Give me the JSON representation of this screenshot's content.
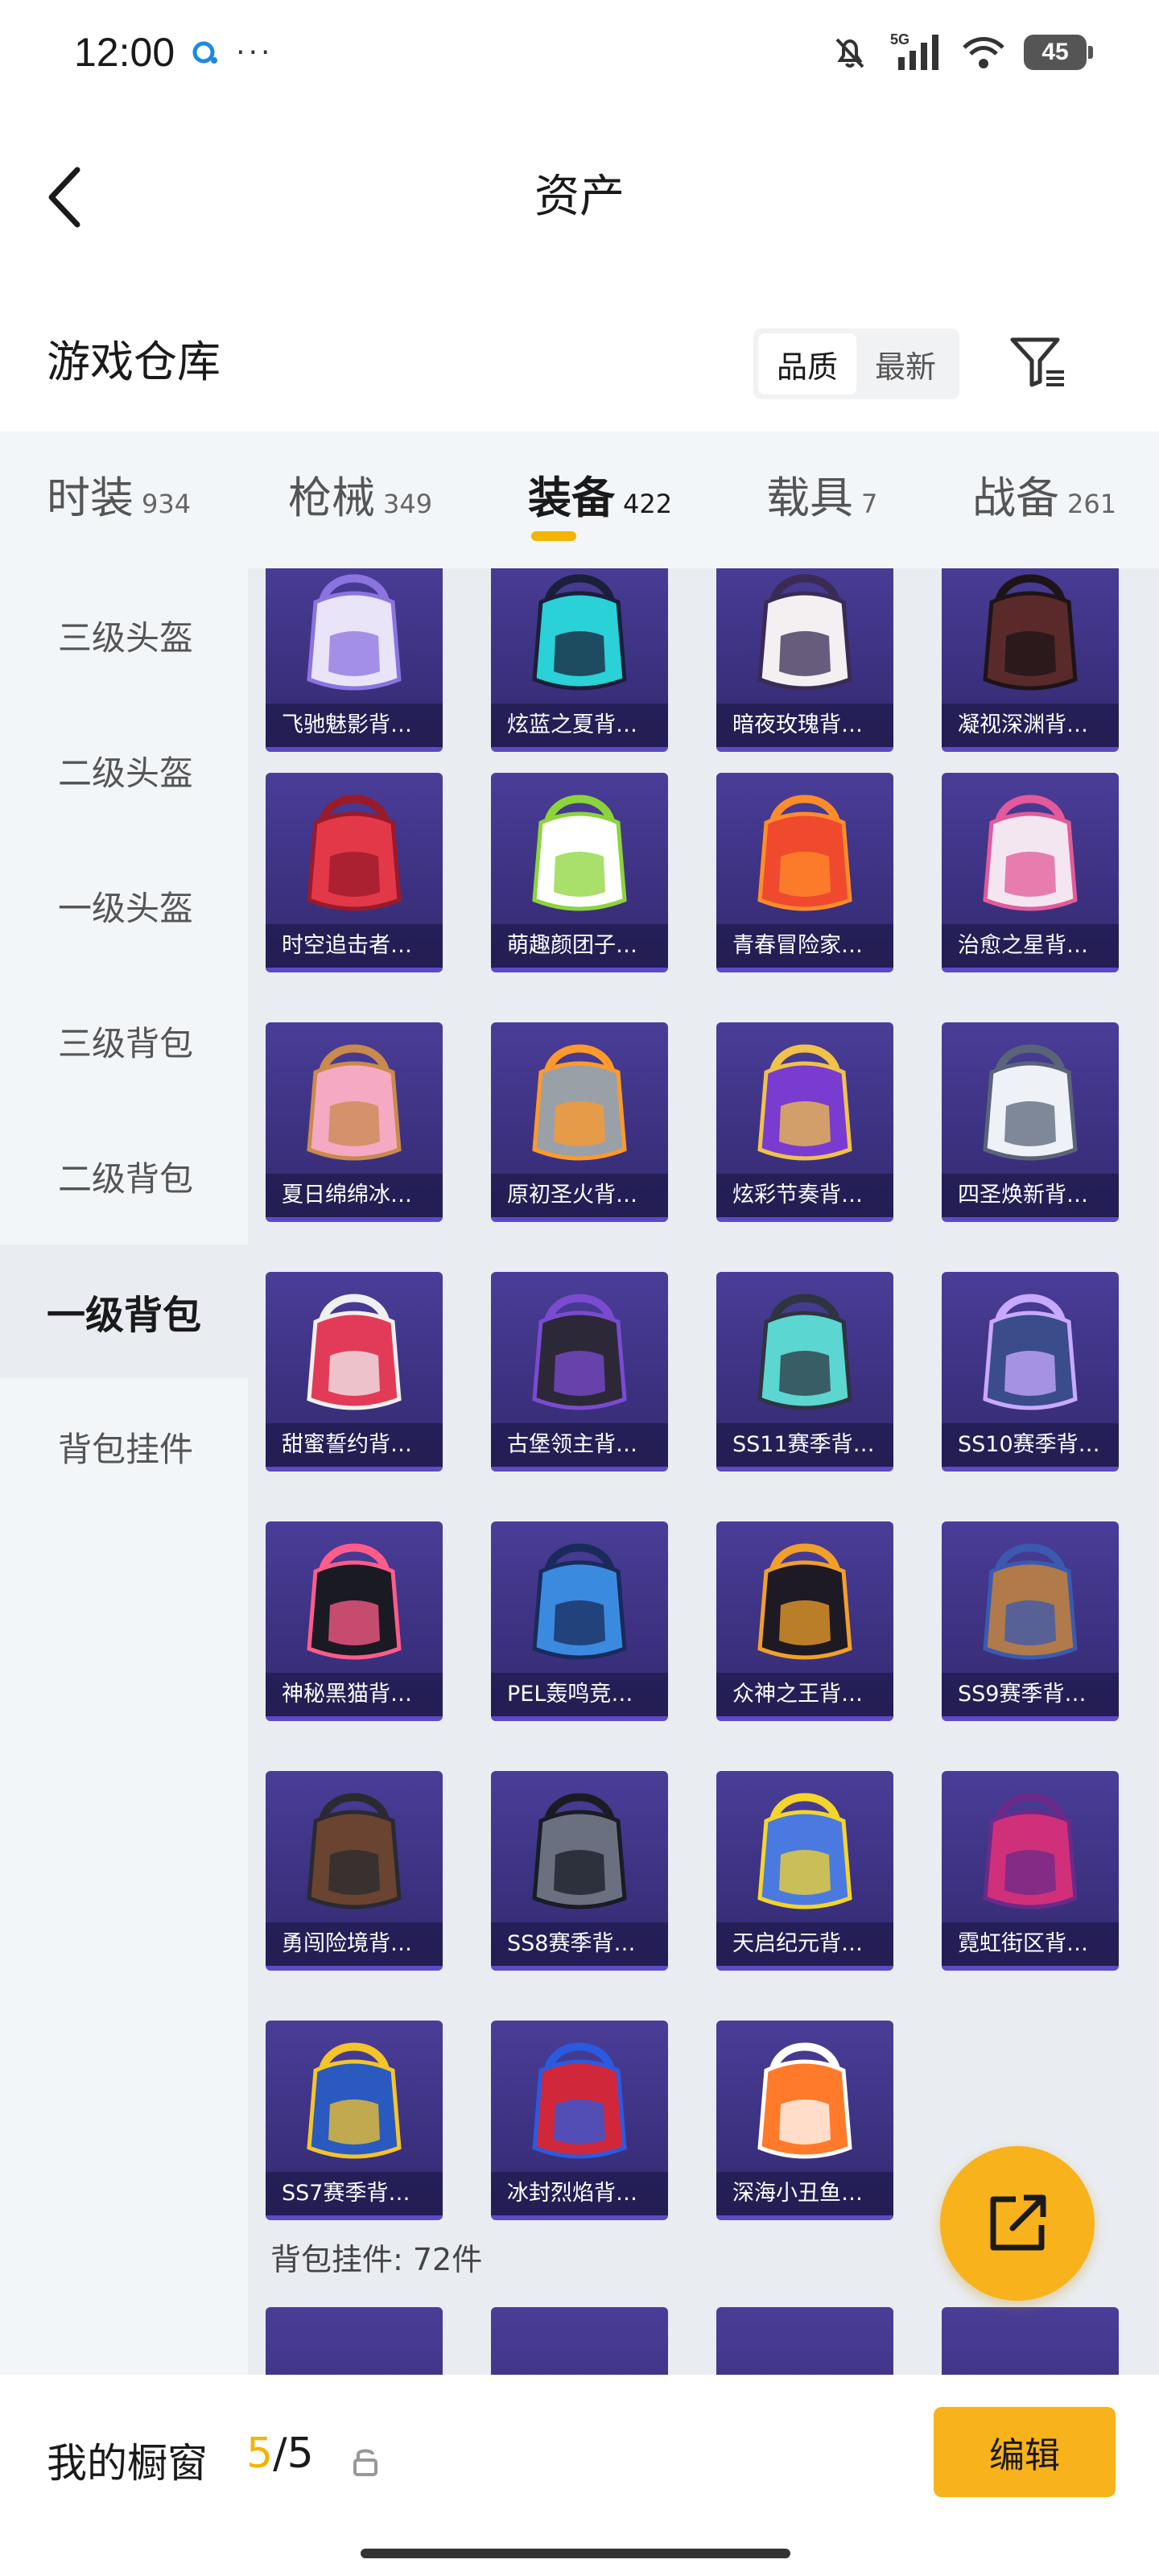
{
  "status_bar": {
    "time": "12:00",
    "dots": "···",
    "network": "5G",
    "battery": "45"
  },
  "header": {
    "title": "资产"
  },
  "warehouse": {
    "title": "游戏仓库",
    "sort_options": [
      "品质",
      "最新"
    ],
    "sort_active": "品质"
  },
  "category_tabs": [
    {
      "label": "时装",
      "count": "934"
    },
    {
      "label": "枪械",
      "count": "349"
    },
    {
      "label": "装备",
      "count": "422",
      "active": true
    },
    {
      "label": "载具",
      "count": "7"
    },
    {
      "label": "战备",
      "count": "261"
    }
  ],
  "sidebar": {
    "items": [
      "三级头盔",
      "二级头盔",
      "一级头盔",
      "三级背包",
      "二级背包",
      "一级背包",
      "背包挂件"
    ],
    "active": "一级背包"
  },
  "items": [
    {
      "name": "飞驰魅影背…",
      "art": "white-purple"
    },
    {
      "name": "炫蓝之夏背…",
      "art": "teal-black"
    },
    {
      "name": "暗夜玫瑰背…",
      "art": "white-bunny"
    },
    {
      "name": "凝视深渊背…",
      "art": "dark-red"
    },
    {
      "name": "时空追击者…",
      "art": "red"
    },
    {
      "name": "萌趣颜团子…",
      "art": "white-blob"
    },
    {
      "name": "青春冒险家…",
      "art": "red-orange"
    },
    {
      "name": "治愈之星背…",
      "art": "pink-white"
    },
    {
      "name": "夏日绵绵冰…",
      "art": "icecream"
    },
    {
      "name": "原初圣火背…",
      "art": "gray-orange"
    },
    {
      "name": "炫彩节奏背…",
      "art": "purple-graffiti"
    },
    {
      "name": "四圣焕新背…",
      "art": "white-mech"
    },
    {
      "name": "甜蜜誓约背…",
      "art": "red-heart"
    },
    {
      "name": "古堡领主背…",
      "art": "black-purple"
    },
    {
      "name": "SS11赛季背…",
      "art": "teal-gray"
    },
    {
      "name": "SS10赛季背…",
      "art": "navy-blue"
    },
    {
      "name": "神秘黑猫背…",
      "art": "black-cat"
    },
    {
      "name": "PEL轰鸣竞…",
      "art": "blue-pixel"
    },
    {
      "name": "众神之王背…",
      "art": "black-gold"
    },
    {
      "name": "SS9赛季背…",
      "art": "brown-blue"
    },
    {
      "name": "勇闯险境背…",
      "art": "brown-anchor"
    },
    {
      "name": "SS8赛季背…",
      "art": "gray-black"
    },
    {
      "name": "天启纪元背…",
      "art": "blue-yellow"
    },
    {
      "name": "霓虹街区背…",
      "art": "magenta"
    },
    {
      "name": "SS7赛季背…",
      "art": "blue-yellow-stripe"
    },
    {
      "name": "冰封烈焰背…",
      "art": "red-blue"
    },
    {
      "name": "深海小丑鱼…",
      "art": "clownfish"
    }
  ],
  "next_section": {
    "label": "背包挂件: 72件"
  },
  "bottom_bar": {
    "title": "我的橱窗",
    "count_current": "5",
    "count_total": "/5",
    "edit_label": "编辑"
  },
  "colors": {
    "accent": "#f8b21b",
    "tile_bg": "#3d3282",
    "sidebar_bg": "#f3f6f9",
    "grid_bg": "#e9edf2"
  }
}
